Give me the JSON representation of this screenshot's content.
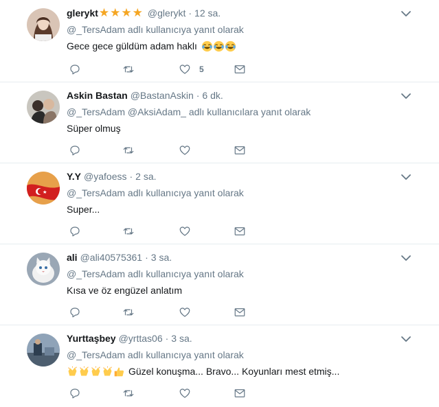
{
  "tweets": [
    {
      "name": "glerykt",
      "stars": [
        "★",
        "★",
        "★",
        "★"
      ],
      "handle": "@glerykt",
      "time": "12 sa.",
      "reply_prefix": "@_TersAdam",
      "reply_suffix": "adlı kullanıcıya yanıt olarak",
      "text": "Gece gece güldüm adam haklı",
      "emoji": "😂😂😂",
      "likes": "5"
    },
    {
      "name": "Askin Bastan",
      "handle": "@BastanAskin",
      "time": "6 dk.",
      "reply_prefix": "@_TersAdam @AksiAdam_",
      "reply_suffix": "adlı kullanıcılara yanıt olarak",
      "text": "Süper olmuş"
    },
    {
      "name": "Y.Y",
      "handle": "@yafoess",
      "time": "2 sa.",
      "reply_prefix": "@_TersAdam",
      "reply_suffix": "adlı kullanıcıya yanıt olarak",
      "text": "Super..."
    },
    {
      "name": "ali",
      "handle": "@ali40575361",
      "time": "3 sa.",
      "reply_prefix": "@_TersAdam",
      "reply_suffix": "adlı kullanıcıya yanıt olarak",
      "text": "Kısa ve öz engüzel anlatım"
    },
    {
      "name": "Yurttaşbey",
      "handle": "@yrttas06",
      "time": "3 sa.",
      "reply_prefix": "@_TersAdam",
      "reply_suffix": "adlı kullanıcıya yanıt olarak",
      "emoji": "👏👏👏👏👍",
      "text": "Güzel konuşma... Bravo... Koyunları mest etmiş..."
    }
  ],
  "colors": {
    "text": "#14171a",
    "secondary": "#657786",
    "divider": "#e6ecf0",
    "star": "#f5a623"
  },
  "icons": [
    "reply-icon",
    "retweet-icon",
    "like-icon",
    "dm-icon",
    "chevron-down-icon"
  ]
}
